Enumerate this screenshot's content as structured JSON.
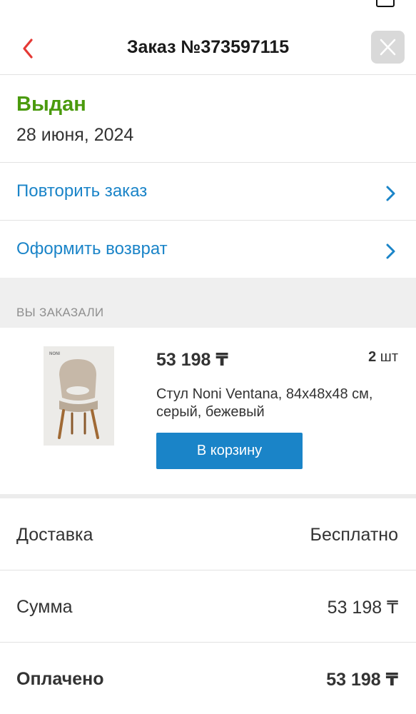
{
  "header": {
    "title": "Заказ №373597115"
  },
  "order": {
    "status": "Выдан",
    "date": "28 июня, 2024",
    "status_color": "#4a9a0d"
  },
  "actions": [
    {
      "label": "Повторить заказ",
      "icon": "chevron-right-icon"
    },
    {
      "label": "Оформить возврат",
      "icon": "chevron-right-icon"
    }
  ],
  "section_caption": "ВЫ ЗАКАЗАЛИ",
  "product": {
    "price": "53 198 ₸",
    "qty_value": "2",
    "qty_unit": "шт",
    "name": "Стул Noni Ventana, 84x48x48 см, серый, бежевый",
    "cart_button": "В корзину",
    "image_brand": "NONI"
  },
  "summary": [
    {
      "key": "Доставка",
      "value": "Бесплатно"
    },
    {
      "key": "Сумма",
      "value": "53 198 ₸"
    },
    {
      "key": "Оплачено",
      "value": "53 198 ₸"
    }
  ],
  "colors": {
    "accent": "#1a84c8",
    "back_arrow": "#e53935",
    "success": "#4a9a0d"
  }
}
